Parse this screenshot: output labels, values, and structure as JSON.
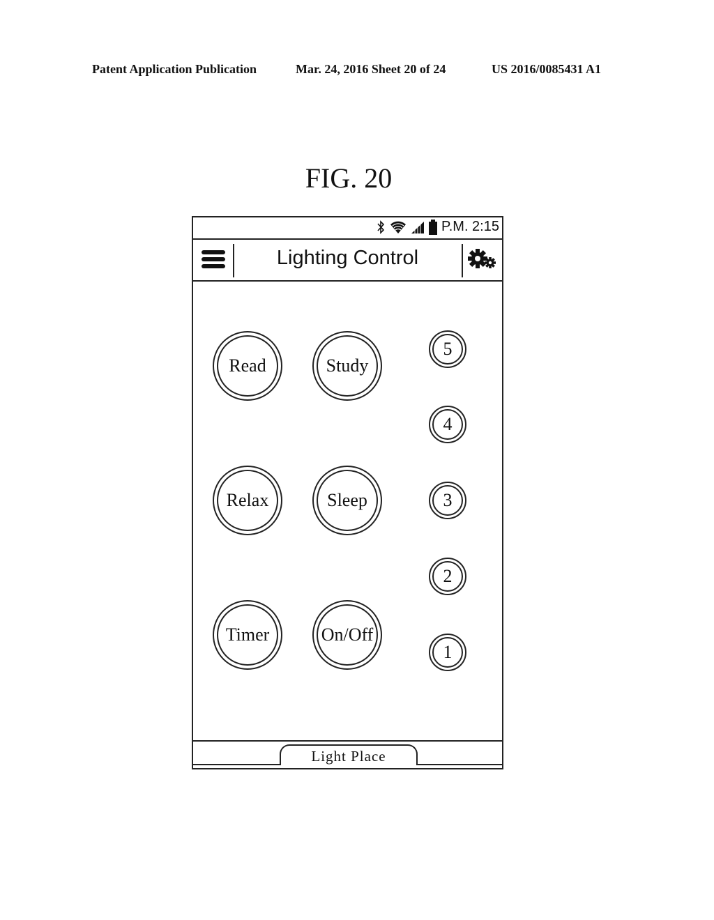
{
  "patent_header": {
    "left": "Patent Application Publication",
    "middle": "Mar. 24, 2016  Sheet 20 of 24",
    "right": "US 2016/0085431 A1"
  },
  "figure_label": "FIG. 20",
  "status_bar": {
    "icons": [
      "bluetooth-icon",
      "wifi-icon",
      "signal-icon",
      "battery-icon"
    ],
    "time": "P.M. 2:15"
  },
  "app_bar": {
    "menu_icon": "hamburger-menu-icon",
    "title": "Lighting Control",
    "settings_icon": "gears-icon"
  },
  "mode_buttons": [
    {
      "label": "Read"
    },
    {
      "label": "Study"
    },
    {
      "label": "Relax"
    },
    {
      "label": "Sleep"
    },
    {
      "label": "Timer"
    },
    {
      "label": "On/Off"
    }
  ],
  "level_buttons": [
    {
      "label": "5"
    },
    {
      "label": "4"
    },
    {
      "label": "3"
    },
    {
      "label": "2"
    },
    {
      "label": "1"
    }
  ],
  "bottom_tab": {
    "label": "Light Place"
  }
}
